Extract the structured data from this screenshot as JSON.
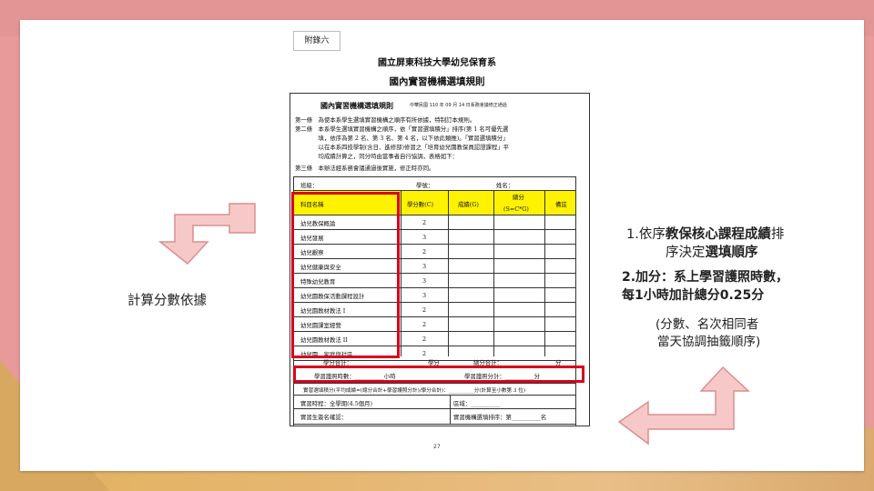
{
  "doc_tag": "附錄六",
  "title_school": "國立屏東科技大學幼兒保育系",
  "title_rule": "國內實習機構選填規則",
  "rule_heading": "國內實習機構選填規則",
  "rule_date": "中華民國 110 年 09 月 14 日系務會議修正通過",
  "articles": [
    "第一條　為使本系學生選填實習機構之順序有所依據，特制訂本規則。",
    "第二條　本系學生選填實習機構之順序，依「實習選填積分」排序(第 1 名可優先選",
    "　　　　填，依序為第 2 名、第 3 名、第 4 名，以下依此類推)。「實習選填積分」",
    "　　　　以在本系四技學制(含日、進修部)修習之「培育幼兒園教保員認證課程」平",
    "　　　　均成績計算之，同分時由當事者自行協調，表格如下：",
    "第三條　本辦法經系務會議通過後實施，修正時亦同。"
  ],
  "form": {
    "class_label": "班級：",
    "student_id_label": "學號：",
    "name_label": "姓名：",
    "headers": [
      "科目名稱",
      "學分數(C)",
      "成績(G)",
      "總分\n(S=C*G)",
      "備註"
    ],
    "total_header_line1": "總分",
    "total_header_line2": "(S=C*G)",
    "courses": [
      {
        "name": "幼兒教保概論",
        "credits": "2"
      },
      {
        "name": "幼兒發展",
        "credits": "3"
      },
      {
        "name": "幼兒觀察",
        "credits": "2"
      },
      {
        "name": "幼兒健康與安全",
        "credits": "3"
      },
      {
        "name": "特殊幼兒教育",
        "credits": "3"
      },
      {
        "name": "幼兒園教保活動課程設計",
        "credits": "3"
      },
      {
        "name": "幼兒園教材教法 I",
        "credits": "2"
      },
      {
        "name": "幼兒園課室經營",
        "credits": "2"
      },
      {
        "name": "幼兒園教材教法 II",
        "credits": "2"
      },
      {
        "name": "幼兒園、家庭與社區",
        "credits": "2"
      }
    ],
    "credit_total_label": "學分合計：",
    "credit_unit": "學分",
    "score_total_label": "總分合計：",
    "score_unit": "分",
    "license_hours": "學習護照時數：__________小時",
    "license_points": "學習護照分計：__________分",
    "score_formula": "實習選填積分(平均成績=(總分合計+學習護照分計)/學分合計)：__________分(計算至小數第 3 位)",
    "period": "實習時程：全學期(4.5個月)",
    "region": "區域：__________",
    "signature": "實習生簽名確認：",
    "rank": "實習機構選填排序：第__________名"
  },
  "page_number": "27",
  "annotations": {
    "left": "計算分數依據",
    "right1_pre": "1.依序",
    "right1_bold": "教保核心課程成績",
    "right1_post": "排",
    "right1_line2_pre": "序決定",
    "right1_line2_bold": "選填順序",
    "right2_line1": "2.加分：系上學習護照時數，",
    "right2_line2": "每1小時加計總分0.25分",
    "right3_line1": "(分數、名次相同者",
    "right3_line2": "當天協調抽籤順序)"
  },
  "colors": {
    "arrow_fill": "#f6c9c8",
    "arrow_stroke": "#d98f8e",
    "highlight": "#fff200",
    "red_box": "#d9001b"
  }
}
